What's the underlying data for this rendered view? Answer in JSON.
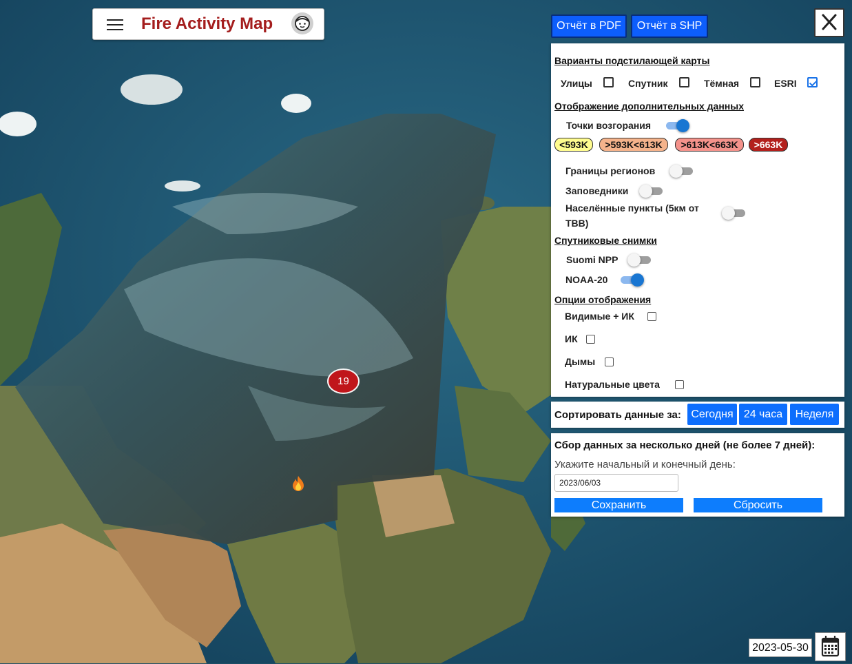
{
  "app": {
    "title": "Fire Activity Map"
  },
  "reports": {
    "pdf_label": "Отчёт в PDF",
    "shp_label": "Отчёт в SHP"
  },
  "basemap": {
    "section_title": "Варианты подстилающей карты",
    "options": [
      {
        "label": "Улицы",
        "checked": false
      },
      {
        "label": "Спутник",
        "checked": false
      },
      {
        "label": "Тёмная",
        "checked": false
      },
      {
        "label": "ESRI",
        "checked": true
      }
    ]
  },
  "extra": {
    "section_title": "Отображение дополнительных данных",
    "hotspots": {
      "label": "Точки возгорания",
      "on": true
    },
    "temp_legend": [
      {
        "label": "<593K",
        "color": "#fffc8f"
      },
      {
        "label": ">593K<613K",
        "color": "#f5b38b"
      },
      {
        "label": ">613K<663K",
        "color": "#f4928b"
      },
      {
        "label": ">663K",
        "color": "#b3201c"
      }
    ],
    "regions": {
      "label": "Границы регионов",
      "on": false
    },
    "reserves": {
      "label": "Заповедники",
      "on": false
    },
    "settlements": {
      "label": "Населённые пункты (5км от ТВВ)",
      "on": false
    }
  },
  "satellites": {
    "section_title": "Спутниковые снимки",
    "suomi": {
      "label": "Suomi NPP",
      "on": false
    },
    "noaa": {
      "label": "NOAA-20",
      "on": true
    }
  },
  "display": {
    "section_title": "Опции отображения",
    "options": [
      {
        "label": "Видимые + ИК",
        "checked": false
      },
      {
        "label": "ИК",
        "checked": false
      },
      {
        "label": "Дымы",
        "checked": false
      },
      {
        "label": "Натуральные цвета",
        "checked": false
      }
    ]
  },
  "sort": {
    "label": "Сортировать данные за:",
    "buttons": [
      "Сегодня",
      "24 часа",
      "Неделя"
    ]
  },
  "range": {
    "title": "Сбор данных за несколько дней (не более 7 дней):",
    "hint": "Укажите начальный и конечный день:",
    "date_value": "2023/06/03",
    "save_label": "Сохранить",
    "reset_label": "Сбросить"
  },
  "map": {
    "cluster_count": "19",
    "current_date": "2023-05-30"
  }
}
